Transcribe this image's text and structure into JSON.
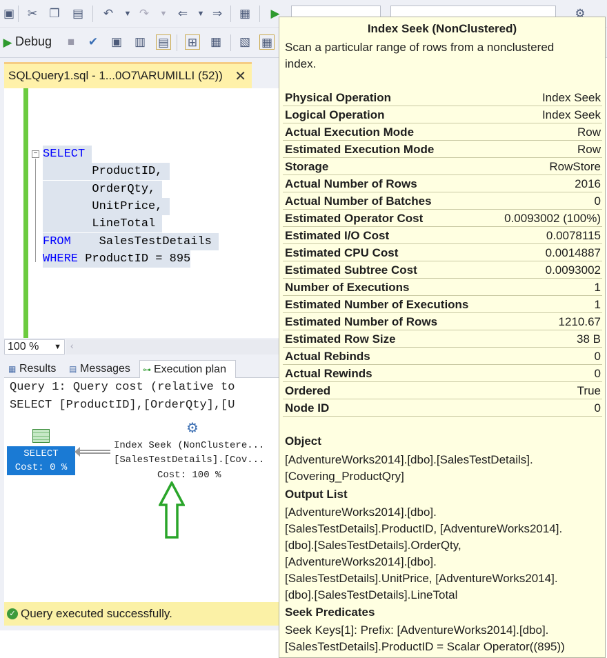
{
  "toolbar": {
    "debug_label": "Debug"
  },
  "editor": {
    "tab_title": "SQLQuery1.sql - 1...0O7\\ARUMILLI (52))",
    "tab_close": "✕",
    "lines": [
      {
        "kw": "SELECT",
        "rest": ""
      },
      {
        "kw": "",
        "rest": "       ProductID,"
      },
      {
        "kw": "",
        "rest": "       OrderQty,"
      },
      {
        "kw": "",
        "rest": "       UnitPrice,"
      },
      {
        "kw": "",
        "rest": "       LineTotal"
      },
      {
        "kw": "FROM",
        "rest": "    SalesTestDetails"
      },
      {
        "kw": "WHERE",
        "rest": " ProductID = 895"
      }
    ],
    "zoom": "100 %"
  },
  "results": {
    "tabs": [
      "Results",
      "Messages",
      "Execution plan"
    ],
    "query_line": "Query 1: Query cost (relative to",
    "select_line": "SELECT [ProductID],[OrderQty],[U",
    "select_node": {
      "label": "SELECT",
      "cost": "Cost: 0 %"
    },
    "seek_node": {
      "line1": "Index Seek (NonClustere...",
      "line2": "[SalesTestDetails].[Cov...",
      "cost": "Cost: 100 %"
    }
  },
  "status": {
    "text": "Query executed successfully."
  },
  "tooltip": {
    "title": "Index Seek (NonClustered)",
    "description": "Scan a particular range of rows from a nonclustered index.",
    "properties": [
      {
        "key": "Physical Operation",
        "value": "Index Seek"
      },
      {
        "key": "Logical Operation",
        "value": "Index Seek"
      },
      {
        "key": "Actual Execution Mode",
        "value": "Row"
      },
      {
        "key": "Estimated Execution Mode",
        "value": "Row"
      },
      {
        "key": "Storage",
        "value": "RowStore"
      },
      {
        "key": "Actual Number of Rows",
        "value": "2016"
      },
      {
        "key": "Actual Number of Batches",
        "value": "0"
      },
      {
        "key": "Estimated Operator Cost",
        "value": "0.0093002 (100%)"
      },
      {
        "key": "Estimated I/O Cost",
        "value": "0.0078115"
      },
      {
        "key": "Estimated CPU Cost",
        "value": "0.0014887"
      },
      {
        "key": "Estimated Subtree Cost",
        "value": "0.0093002"
      },
      {
        "key": "Number of Executions",
        "value": "1"
      },
      {
        "key": "Estimated Number of Executions",
        "value": "1"
      },
      {
        "key": "Estimated Number of Rows",
        "value": "1210.67"
      },
      {
        "key": "Estimated Row Size",
        "value": "38 B"
      },
      {
        "key": "Actual Rebinds",
        "value": "0"
      },
      {
        "key": "Actual Rewinds",
        "value": "0"
      },
      {
        "key": "Ordered",
        "value": "True"
      },
      {
        "key": "Node ID",
        "value": "0"
      }
    ],
    "object_heading": "Object",
    "object_lines": [
      "[AdventureWorks2014].[dbo].[SalesTestDetails].",
      "[Covering_ProductQry]"
    ],
    "output_heading": "Output List",
    "output_lines": [
      "[AdventureWorks2014].[dbo].",
      "[SalesTestDetails].ProductID, [AdventureWorks2014].",
      "[dbo].[SalesTestDetails].OrderQty,",
      "[AdventureWorks2014].[dbo].",
      "[SalesTestDetails].UnitPrice, [AdventureWorks2014].",
      "[dbo].[SalesTestDetails].LineTotal"
    ],
    "seek_heading": "Seek Predicates",
    "seek_lines": [
      "Seek Keys[1]: Prefix: [AdventureWorks2014].[dbo].",
      "[SalesTestDetails].ProductID = Scalar Operator((895))"
    ]
  }
}
